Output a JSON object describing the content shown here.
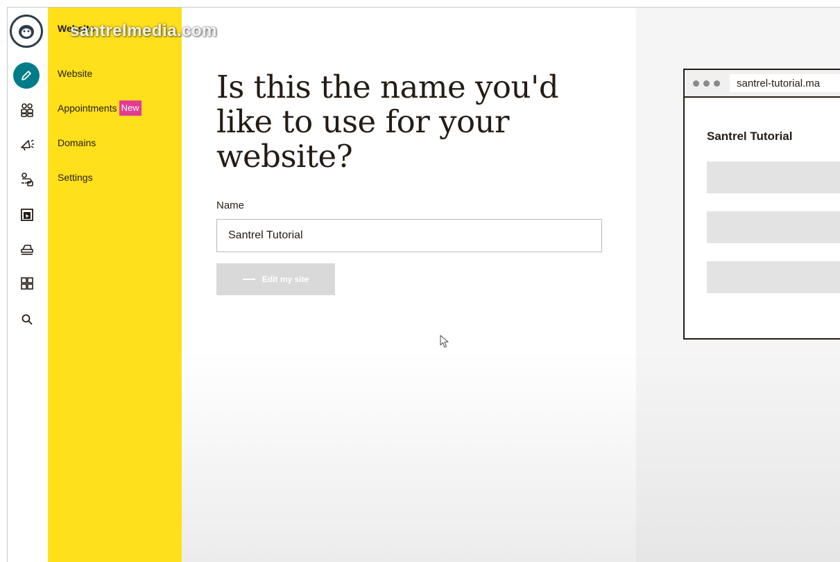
{
  "watermark": "santrelmedia.com",
  "rail": {
    "icons": [
      "mailchimp-logo-icon",
      "pencil-create-icon",
      "audience-icon",
      "campaigns-icon",
      "automations-icon",
      "website-icon",
      "integrations-icon",
      "content-icon",
      "search-icon"
    ]
  },
  "submenu": {
    "title": "Website",
    "items": [
      {
        "label": "Website"
      },
      {
        "label": "Appointments",
        "badge": "New"
      },
      {
        "label": "Domains"
      },
      {
        "label": "Settings"
      }
    ]
  },
  "main": {
    "heading": "Is this the name you'd like to use for your website?",
    "name_label": "Name",
    "name_value": "Santrel Tutorial",
    "edit_button_label": "Edit my site"
  },
  "preview": {
    "url": "santrel-tutorial.ma",
    "site_title": "Santrel Tutorial"
  },
  "colors": {
    "submenu_bg": "#ffe01b",
    "active_icon_bg": "#007c89",
    "badge_bg": "#e33a94",
    "button_disabled_bg": "#d9d9d9"
  }
}
